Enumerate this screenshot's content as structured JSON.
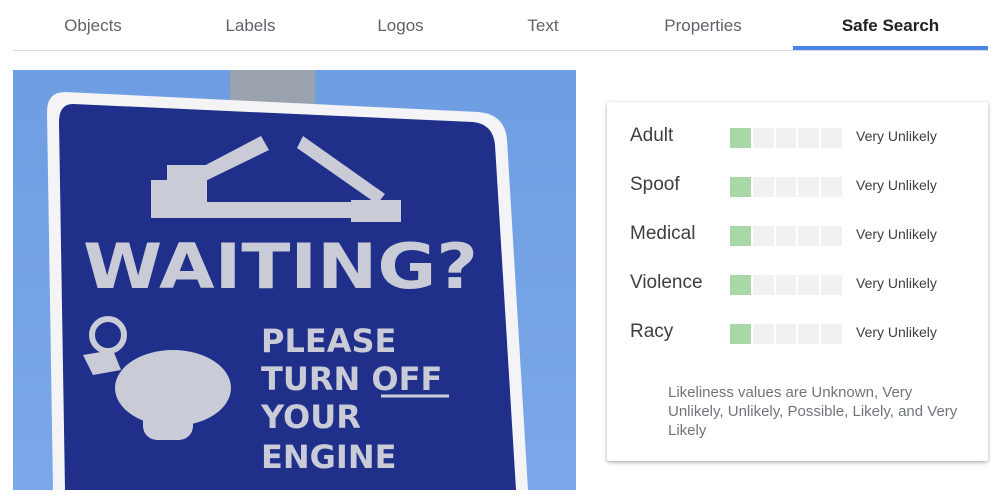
{
  "tabs": [
    {
      "label": "Objects",
      "active": false
    },
    {
      "label": "Labels",
      "active": false
    },
    {
      "label": "Logos",
      "active": false
    },
    {
      "label": "Text",
      "active": false
    },
    {
      "label": "Properties",
      "active": false
    },
    {
      "label": "Safe Search",
      "active": true
    }
  ],
  "colors": {
    "accent": "#4a86e8",
    "meter_on": "#a8d8a5",
    "meter_off": "#f1f1f1",
    "sky": "#6f9fe0",
    "sign_blue": "#1f2f8a"
  },
  "image": {
    "sign_title": "WAITING?",
    "sign_lines": [
      "PLEASE",
      "TURN OFF",
      "YOUR",
      "ENGINE"
    ]
  },
  "safe_search": {
    "rows": [
      {
        "label": "Adult",
        "level": 1,
        "max": 5,
        "value": "Very Unlikely"
      },
      {
        "label": "Spoof",
        "level": 1,
        "max": 5,
        "value": "Very Unlikely"
      },
      {
        "label": "Medical",
        "level": 1,
        "max": 5,
        "value": "Very Unlikely"
      },
      {
        "label": "Violence",
        "level": 1,
        "max": 5,
        "value": "Very Unlikely"
      },
      {
        "label": "Racy",
        "level": 1,
        "max": 5,
        "value": "Very Unlikely"
      }
    ],
    "footnote": "Likeliness values are Unknown, Very Unlikely, Unlikely, Possible, Likely, and Very Likely"
  }
}
